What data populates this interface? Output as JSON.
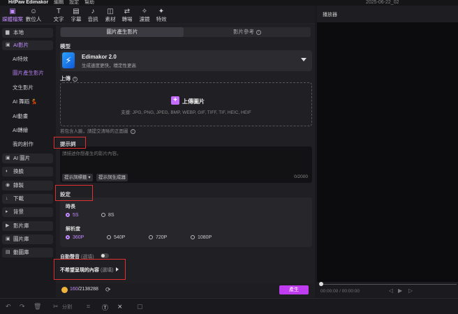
{
  "titlebar": {
    "app": "HitPaw Edimakor",
    "menu_edit": "編輯",
    "menu_settings": "設定",
    "menu_help": "幫助",
    "date": "2025-06-22_02"
  },
  "toolbar": {
    "items": [
      {
        "label": "媒體檔案",
        "icon": "media-icon",
        "active": true
      },
      {
        "label": "數位人",
        "icon": "avatar-icon"
      },
      {
        "label": "文字",
        "icon": "text-icon"
      },
      {
        "label": "字幕",
        "icon": "subtitle-icon"
      },
      {
        "label": "音訊",
        "icon": "audio-icon"
      },
      {
        "label": "素材",
        "icon": "assets-icon"
      },
      {
        "label": "轉場",
        "icon": "transition-icon"
      },
      {
        "label": "濾鏡",
        "icon": "filter-icon"
      },
      {
        "label": "特效",
        "icon": "effects-icon"
      }
    ]
  },
  "sidebar": {
    "local": "本地",
    "ai_video": "AI影片",
    "ai_sub": [
      "AI特效",
      "圖片產生影片",
      "文生影片",
      "AI 舞蹈 💃",
      "AI動畫",
      "AI轉繪",
      "我的創作"
    ],
    "ai_image": "AI 圖片",
    "face_swap": "換臉",
    "record": "錄製",
    "download": "下載",
    "background": "背景",
    "video_lib": "影片庫",
    "image_lib": "圖片庫",
    "gif_lib": "動圖庫"
  },
  "main": {
    "tab_active": "圖片產生影片",
    "tab_other": "影片參考",
    "model_label": "模型",
    "model_name": "Edimakor 2.0",
    "model_desc": "生成速度更快，穩定性更高",
    "upload_label": "上傳",
    "upload_btn": "上傳圖片",
    "upload_formats": "支援: JPG, PNG, JPEG, BMP, WEBP, GIF, TIFF, TIF, HEIC, HEIF",
    "upload_hint": "若包含人臉，請提交清晰的正面圖",
    "prompt_label": "提示詞",
    "prompt_placeholder": "請描述你想產生的影片內容。",
    "prompt_tag_btn": "提示詞標籤",
    "prompt_gen_btn": "提示詞生成器",
    "prompt_count": "0/2000",
    "settings_label": "設定",
    "duration_label": "時長",
    "duration_opts": [
      "5S",
      "8S"
    ],
    "resolution_label": "解析度",
    "resolution_opts": [
      "360P",
      "540P",
      "720P",
      "1080P"
    ],
    "auto_audio": "自動聲音",
    "auto_audio_opt": "(選填)",
    "negative_label": "不希望呈現的內容",
    "negative_opt": "(選填)",
    "credits_used": "160",
    "credits_total": "/2138288",
    "generate_btn": "產生"
  },
  "player": {
    "title": "播放器",
    "time": "00:00:00 / 00:00:00"
  },
  "bottom": {
    "split": "分割"
  }
}
